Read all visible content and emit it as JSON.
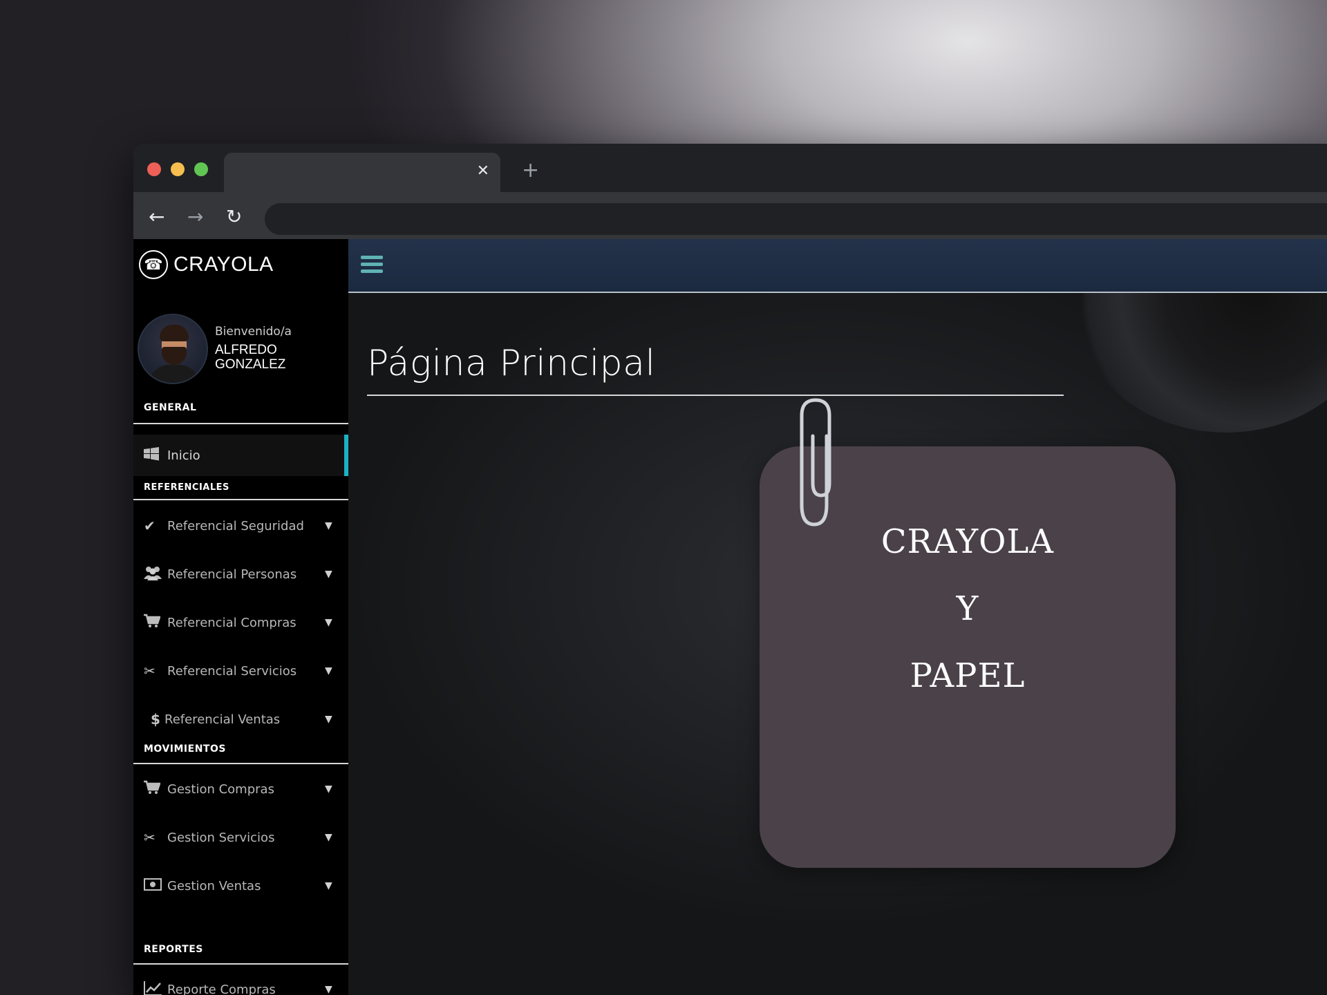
{
  "browser": {
    "tab_close": "✕",
    "new_tab": "+",
    "back": "←",
    "forward": "→",
    "reload": "↻"
  },
  "brand": {
    "icon": "phone-icon",
    "name": "CRAYOLA"
  },
  "user": {
    "welcome": "Bienvenido/a",
    "name": "ALFREDO GONZALEZ"
  },
  "sidebar": {
    "sections": {
      "general": "GENERAL",
      "referenciales": "REFERENCIALES",
      "movimientos": "MOVIMIENTOS",
      "reportes": "REPORTES"
    },
    "items": [
      {
        "label": "Inicio",
        "icon": "windows-icon"
      },
      {
        "label": "Referencial Seguridad",
        "icon": "check-icon"
      },
      {
        "label": "Referencial Personas",
        "icon": "users-icon"
      },
      {
        "label": "Referencial Compras",
        "icon": "cart-icon"
      },
      {
        "label": "Referencial Servicios",
        "icon": "scissors-icon"
      },
      {
        "label": "Referencial Ventas",
        "icon": "dollar-icon"
      },
      {
        "label": "Gestion Compras",
        "icon": "cart-icon"
      },
      {
        "label": "Gestion Servicios",
        "icon": "scissors-icon"
      },
      {
        "label": "Gestion Ventas",
        "icon": "money-icon"
      },
      {
        "label": "Reporte Compras",
        "icon": "line-chart-icon"
      }
    ],
    "active_accent": "#1bb3c4"
  },
  "main": {
    "title": "Página Principal",
    "card": {
      "line1": "CRAYOLA",
      "line2": "Y",
      "line3": "PAPEL"
    }
  }
}
